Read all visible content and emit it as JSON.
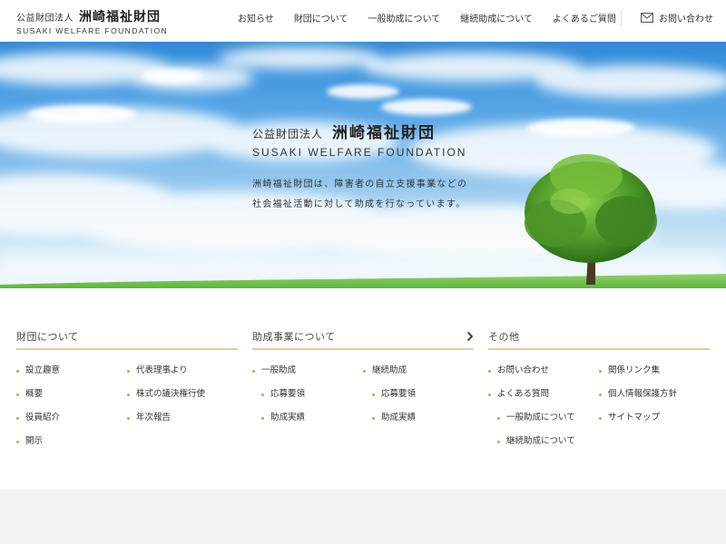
{
  "header": {
    "logo_small": "公益財団法人",
    "logo_big": "洲崎福祉財団",
    "logo_en": "SUSAKI WELFARE FOUNDATION",
    "nav": [
      "お知らせ",
      "財団について",
      "一般助成について",
      "継続助成について",
      "よくあるご質問"
    ],
    "contact_label": "お問い合わせ",
    "contact_icon": "mail-icon"
  },
  "hero": {
    "small": "公益財団法人",
    "big": "洲崎福祉財団",
    "en": "SUSAKI WELFARE FOUNDATION",
    "desc_line1": "洲崎福祉財団は、障害者の自立支援事業などの",
    "desc_line2": "社会福祉活動に対して助成を行なっています。"
  },
  "columns": [
    {
      "title": "財団について",
      "has_chevron": false,
      "left": [
        "設立趣意",
        "概要",
        "役員紹介",
        "開示"
      ],
      "right": [
        "代表理事より",
        "株式の議決権行使",
        "年次報告"
      ]
    },
    {
      "title": "助成事業について",
      "has_chevron": true,
      "left": [
        "一般助成",
        "応募要領",
        "助成実績"
      ],
      "right": [
        "継続助成",
        "応募要領",
        "助成実績"
      ]
    },
    {
      "title": "その他",
      "has_chevron": false,
      "left": [
        "お問い合わせ",
        "よくある質問",
        "一般助成について",
        "継続助成について"
      ],
      "right": [
        "関係リンク集",
        "個人情報保護方針",
        "サイトマップ"
      ]
    }
  ],
  "colors": {
    "accent_line": "#d8cfa8",
    "bullet": "#b7a86c",
    "sky_top": "#2f8ad9"
  }
}
